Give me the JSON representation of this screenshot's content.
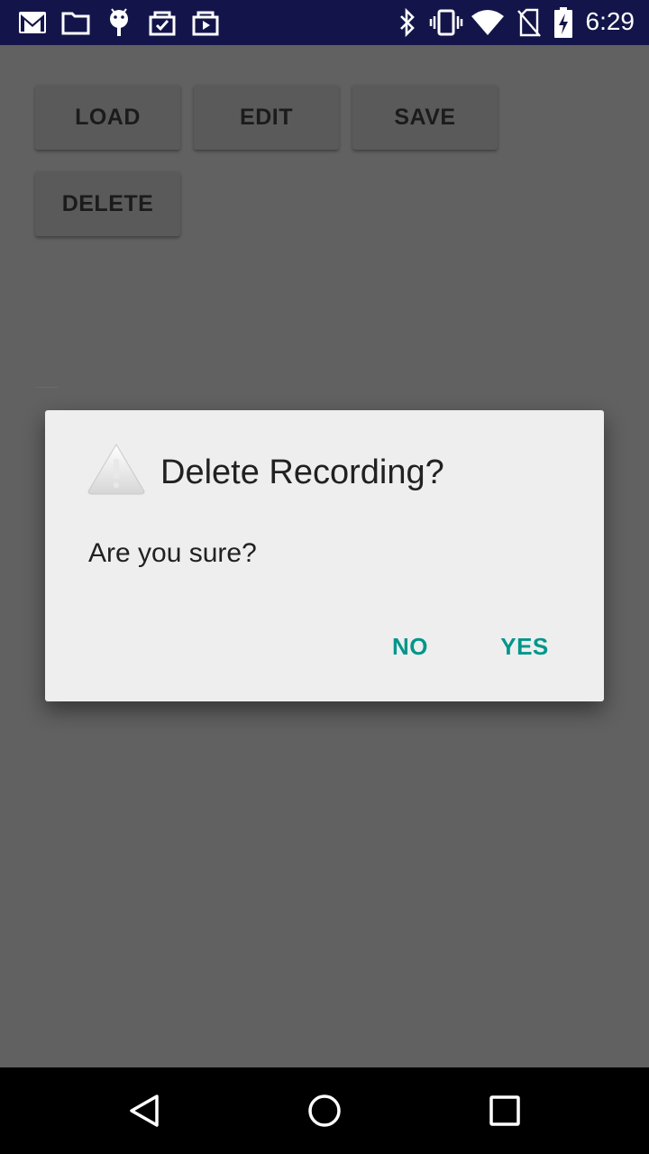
{
  "status_bar": {
    "time": "6:29",
    "left_icons": [
      "gmail-icon",
      "folder-icon",
      "android-debug-icon",
      "task-icon",
      "media-icon"
    ],
    "right_icons": [
      "bluetooth-icon",
      "vibrate-icon",
      "wifi-icon",
      "no-sim-icon",
      "battery-charging-icon"
    ]
  },
  "toolbar": {
    "load_label": "LOAD",
    "edit_label": "EDIT",
    "save_label": "SAVE",
    "delete_label": "DELETE"
  },
  "dialog": {
    "icon": "warning-icon",
    "title": "Delete Recording?",
    "message": "Are you sure?",
    "no_label": "NO",
    "yes_label": "YES",
    "accent_color": "#00968a"
  },
  "nav_bar": {
    "icons": [
      "back-icon",
      "home-icon",
      "recents-icon"
    ]
  }
}
